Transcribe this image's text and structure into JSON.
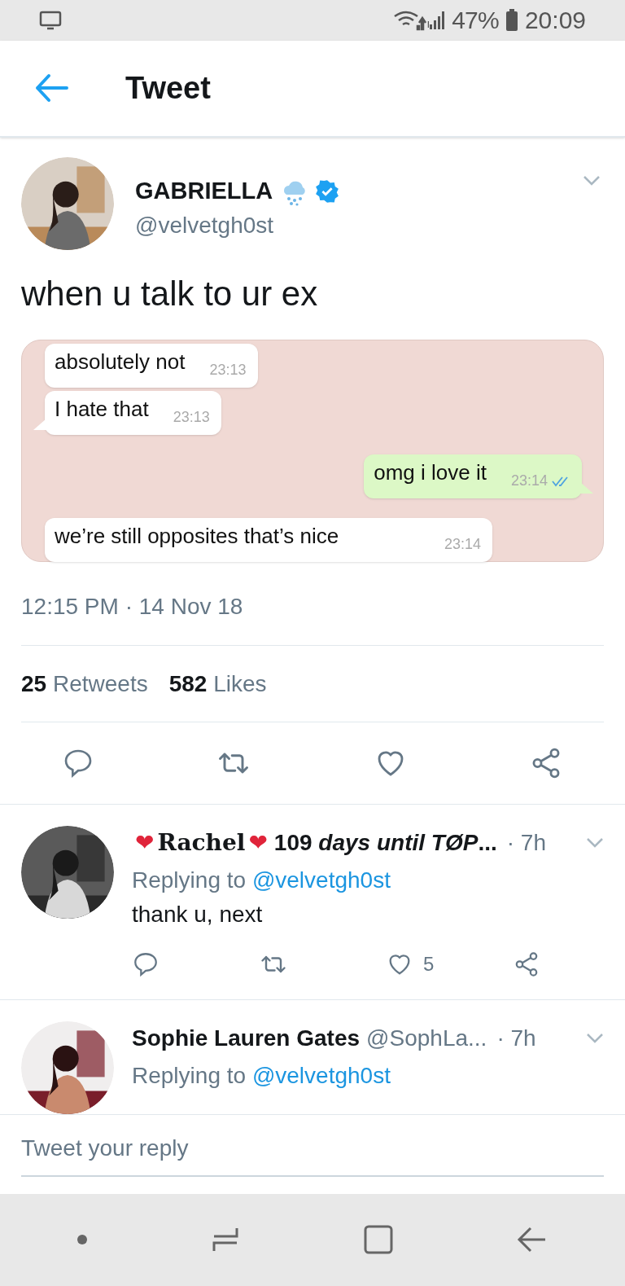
{
  "status_bar": {
    "battery": "47%",
    "time": "20:09"
  },
  "header": {
    "title": "Tweet"
  },
  "tweet": {
    "name": "GABRIELLA",
    "verified": true,
    "handle": "@velvetgh0st",
    "text": "when u talk to ur ex",
    "chat": [
      {
        "kind": "incoming",
        "text": "absolutely not",
        "time": "23:13",
        "read": false,
        "tail": false
      },
      {
        "kind": "incoming",
        "text": "I hate that",
        "time": "23:13",
        "read": false,
        "tail": true
      },
      {
        "kind": "outgoing",
        "text": "omg i love it",
        "time": "23:14",
        "read": true,
        "tail": true
      },
      {
        "kind": "incoming",
        "text": "we’re still opposites that’s nice",
        "time": "23:14",
        "read": false,
        "tail": false
      }
    ],
    "timestamp": "12:15 PM · 14 Nov 18",
    "stats": [
      {
        "count": "25",
        "label": "Retweets"
      },
      {
        "count": "582",
        "label": "Likes"
      }
    ]
  },
  "replies": [
    {
      "name_parts": [
        {
          "kind": "emoji",
          "text": "❤"
        },
        {
          "kind": "blackletter",
          "text": "Rachel"
        },
        {
          "kind": "emoji",
          "text": "❤"
        },
        {
          "kind": "rich",
          "text": "109 *days until TØP*..."
        }
      ],
      "time": "· 7h",
      "replying_label": "Replying to",
      "replying_to": "@velvetgh0st",
      "text": "thank u, next",
      "likes": "5"
    },
    {
      "name_parts": [
        {
          "kind": "plain",
          "text": "Sophie Lauren Gates"
        }
      ],
      "handle": "@SophLa...",
      "time": "· 7h",
      "replying_label": "Replying to",
      "replying_to": "@velvetgh0st"
    }
  ],
  "reply_bar": {
    "placeholder": "Tweet your reply"
  }
}
